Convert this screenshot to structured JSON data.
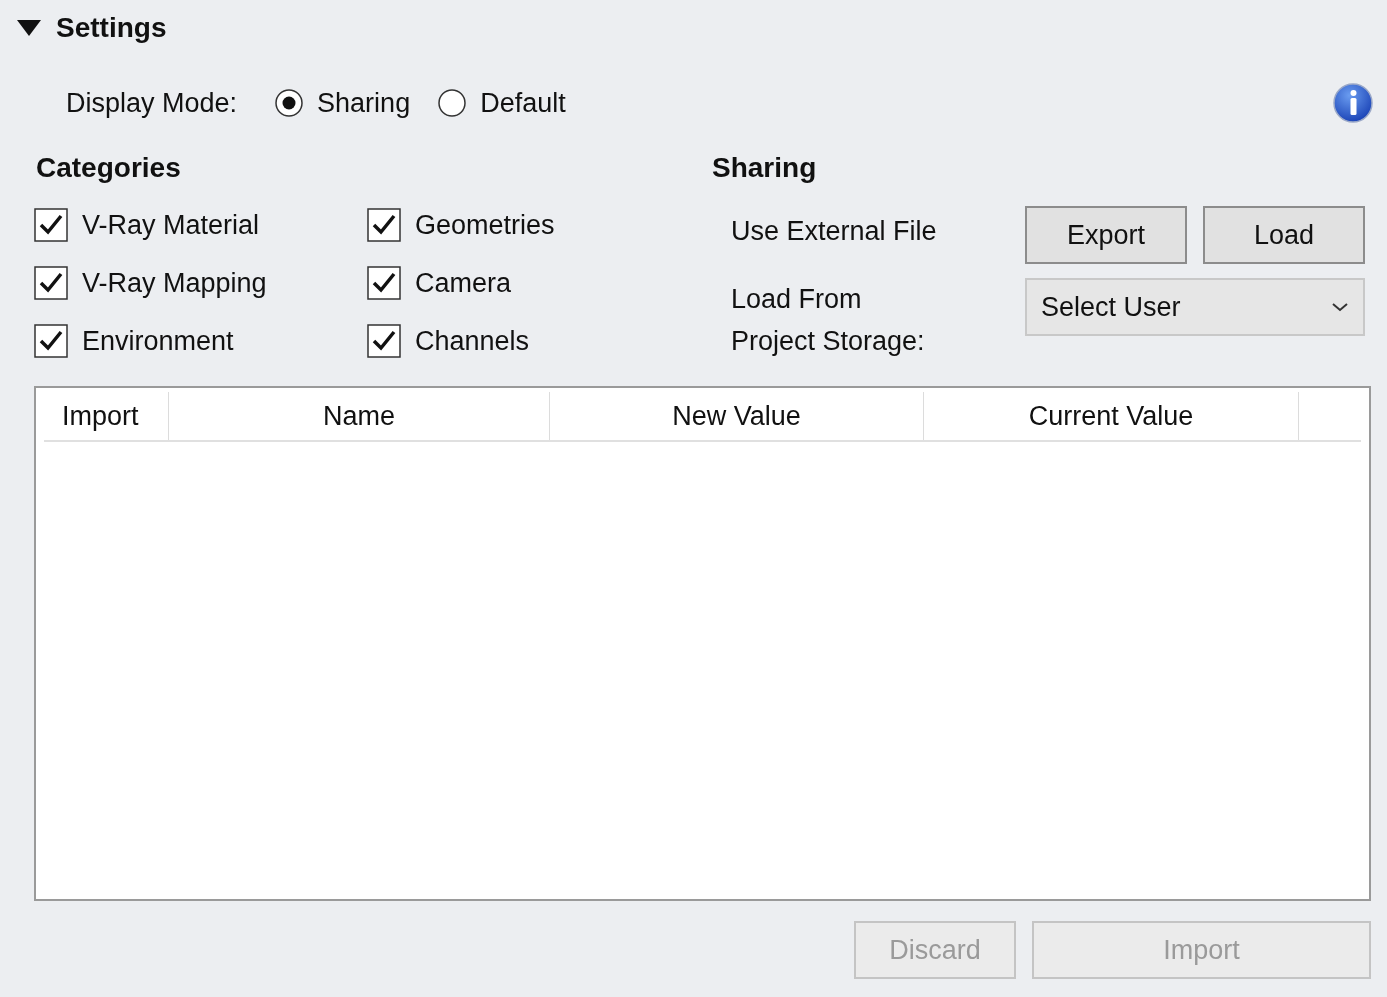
{
  "section": {
    "title": "Settings",
    "expanded": true
  },
  "display_mode": {
    "label": "Display Mode:",
    "options": [
      {
        "label": "Sharing",
        "selected": true
      },
      {
        "label": "Default",
        "selected": false
      }
    ]
  },
  "categories": {
    "title": "Categories",
    "items": [
      {
        "label": "V-Ray Material",
        "checked": true
      },
      {
        "label": "Geometries",
        "checked": true
      },
      {
        "label": "V-Ray Mapping",
        "checked": true
      },
      {
        "label": "Camera",
        "checked": true
      },
      {
        "label": "Environment",
        "checked": true
      },
      {
        "label": "Channels",
        "checked": true
      }
    ]
  },
  "sharing": {
    "title": "Sharing",
    "external_label": "Use External File",
    "export_button": "Export",
    "load_button": "Load",
    "storage_label": "Load From\nProject Storage:",
    "user_select": {
      "value": "Select User"
    }
  },
  "table": {
    "columns": [
      "Import",
      "Name",
      "New Value",
      "Current Value"
    ]
  },
  "footer": [
    {
      "label": "Discard",
      "disabled": true
    },
    {
      "label": "Import",
      "disabled": true
    }
  ]
}
